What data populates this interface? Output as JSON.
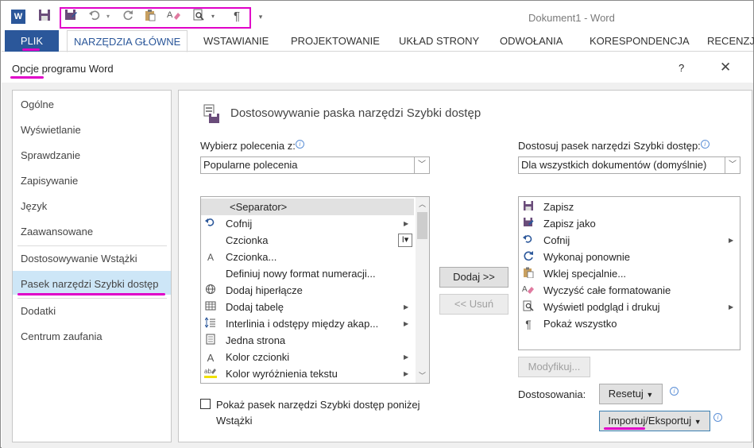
{
  "window": {
    "title": "Dokument1 - Word",
    "logo": "W",
    "qat_icons": [
      "save-icon",
      "save-as-icon",
      "undo-icon",
      "redo-icon",
      "paste-special-icon",
      "clear-formatting-icon",
      "print-preview-icon",
      "pilcrow-icon"
    ]
  },
  "ribbon": {
    "tabs": [
      "PLIK",
      "NARZĘDZIA GŁÓWNE",
      "WSTAWIANIE",
      "PROJEKTOWANIE",
      "UKŁAD STRONY",
      "ODWOŁANIA",
      "KORESPONDENCJA",
      "RECENZJ"
    ]
  },
  "dialog": {
    "title": "Opcje programu Word",
    "help": "?",
    "close": "✕"
  },
  "nav": {
    "items": [
      "Ogólne",
      "Wyświetlanie",
      "Sprawdzanie",
      "Zapisywanie",
      "Język",
      "Zaawansowane",
      "Dostosowywanie Wstążki",
      "Pasek narzędzi Szybki dostęp",
      "Dodatki",
      "Centrum zaufania"
    ],
    "selected": "Pasek narzędzi Szybki dostęp"
  },
  "main": {
    "heading": "Dostosowywanie paska narzędzi Szybki dostęp",
    "choose_label": "Wybierz polecenia z:",
    "choose_value": "Popularne polecenia",
    "customize_label": "Dostosuj pasek narzędzi Szybki dostęp:",
    "customize_value": "Dla wszystkich dokumentów (domyślnie)",
    "commands": [
      {
        "label": "<Separator>",
        "icon": ""
      },
      {
        "label": "Cofnij",
        "icon": "undo-icon"
      },
      {
        "label": "Czcionka",
        "icon": ""
      },
      {
        "label": "Czcionka...",
        "icon": "font-icon"
      },
      {
        "label": "Definiuj nowy format numeracji...",
        "icon": ""
      },
      {
        "label": "Dodaj hiperłącze",
        "icon": "hyperlink-icon"
      },
      {
        "label": "Dodaj tabelę",
        "icon": "table-icon"
      },
      {
        "label": "Interlinia i odstępy między akap...",
        "icon": "line-spacing-icon"
      },
      {
        "label": "Jedna strona",
        "icon": "page-icon"
      },
      {
        "label": "Kolor czcionki",
        "icon": "font-color-icon"
      },
      {
        "label": "Kolor wyróżnienia tekstu",
        "icon": "highlight-icon"
      }
    ],
    "qat_items": [
      {
        "label": "Zapisz",
        "icon": "save-icon"
      },
      {
        "label": "Zapisz jako",
        "icon": "save-as-icon"
      },
      {
        "label": "Cofnij",
        "icon": "undo-icon"
      },
      {
        "label": "Wykonaj ponownie",
        "icon": "redo-icon"
      },
      {
        "label": "Wklej specjalnie...",
        "icon": "paste-special-icon"
      },
      {
        "label": "Wyczyść całe formatowanie",
        "icon": "clear-formatting-icon"
      },
      {
        "label": "Wyświetl podgląd i drukuj",
        "icon": "print-preview-icon"
      },
      {
        "label": "Pokaż wszystko",
        "icon": "pilcrow-icon"
      }
    ],
    "add_button": "Dodaj >>",
    "remove_button": "<< Usuń",
    "modify_button": "Modyfikuj...",
    "customizations_label": "Dostosowania:",
    "reset_button": "Resetuj",
    "import_export_button": "Importuj/Eksportuj",
    "show_below_checkbox": "Pokaż pasek narzędzi Szybki dostęp poniżej Wstążki",
    "show_below_checked": false
  },
  "colors": {
    "accent": "#2b579a",
    "annotation": "#e000c8",
    "selection": "#cde6f7"
  }
}
